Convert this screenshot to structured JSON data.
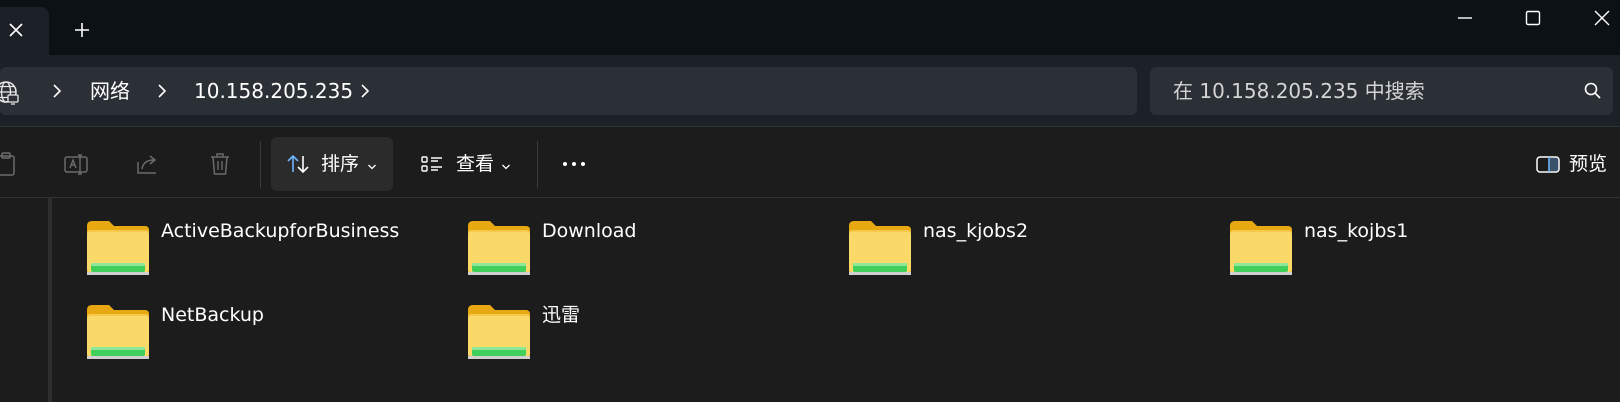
{
  "window": {
    "tab_close_icon": "close-icon",
    "new_tab_icon": "plus-icon",
    "controls": [
      "minimize-icon",
      "maximize-icon",
      "close-icon"
    ]
  },
  "breadcrumb": {
    "root_icon": "network-globe-icon",
    "items": [
      "网络",
      "10.158.205.235"
    ]
  },
  "search": {
    "placeholder": "在 10.158.205.235 中搜索",
    "icon": "search-icon"
  },
  "toolbar": {
    "sort_label": "排序",
    "view_label": "查看",
    "preview_label": "预览",
    "more_icon": "more-horizontal-icon"
  },
  "folders": [
    "ActiveBackupforBusiness",
    "Download",
    "nas_kjobs2",
    "nas_kojbs1",
    "NetBackup",
    "迅雷"
  ],
  "colors": {
    "titlebar": "#0c1116",
    "navbar": "#1c2127",
    "field": "#2b3036",
    "content": "#1c1c1c",
    "folder_yellow": "#f7d05a",
    "folder_green": "#3fcf5a",
    "accent_blue": "#6fb5ff"
  }
}
